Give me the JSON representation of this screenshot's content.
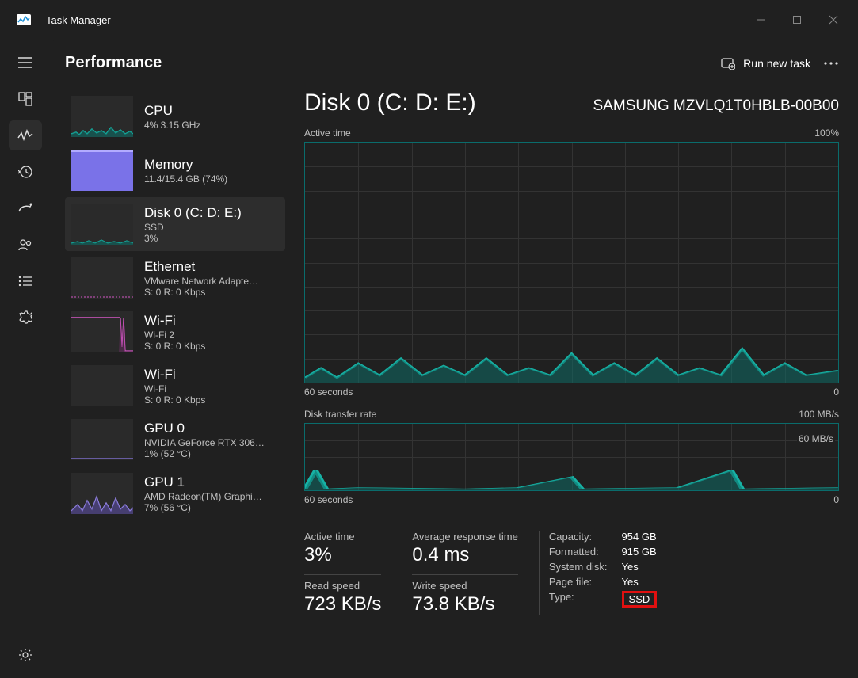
{
  "app": {
    "title": "Task Manager"
  },
  "header": {
    "page_title": "Performance",
    "run_new_task_label": "Run new task"
  },
  "sidebar": {
    "items": [
      {
        "title": "CPU",
        "line1": "4%  3.15 GHz",
        "line2": ""
      },
      {
        "title": "Memory",
        "line1": "11.4/15.4 GB (74%)",
        "line2": ""
      },
      {
        "title": "Disk 0 (C: D: E:)",
        "line1": "SSD",
        "line2": "3%"
      },
      {
        "title": "Ethernet",
        "line1": "VMware Network Adapte…",
        "line2": "S: 0  R: 0 Kbps"
      },
      {
        "title": "Wi-Fi",
        "line1": "Wi-Fi 2",
        "line2": "S: 0  R: 0 Kbps"
      },
      {
        "title": "Wi-Fi",
        "line1": "Wi-Fi",
        "line2": "S: 0  R: 0 Kbps"
      },
      {
        "title": "GPU 0",
        "line1": "NVIDIA GeForce RTX 306…",
        "line2": "1%  (52 °C)"
      },
      {
        "title": "GPU 1",
        "line1": "AMD Radeon(TM) Graphi…",
        "line2": "7%  (56 °C)"
      }
    ]
  },
  "main": {
    "title": "Disk 0 (C: D: E:)",
    "device_name": "SAMSUNG MZVLQ1T0HBLB-00B00",
    "chart1": {
      "label_left": "Active time",
      "label_right": "100%",
      "x_left": "60 seconds",
      "x_right": "0"
    },
    "chart2": {
      "label_left": "Disk transfer rate",
      "label_right": "100 MB/s",
      "inline_label": "60 MB/s",
      "x_left": "60 seconds",
      "x_right": "0"
    },
    "stats": {
      "active_time": {
        "label": "Active time",
        "value": "3%"
      },
      "avg_response": {
        "label": "Average response time",
        "value": "0.4 ms"
      },
      "read_speed": {
        "label": "Read speed",
        "value": "723 KB/s"
      },
      "write_speed": {
        "label": "Write speed",
        "value": "73.8 KB/s"
      }
    },
    "props": {
      "capacity": {
        "label": "Capacity:",
        "value": "954 GB"
      },
      "formatted": {
        "label": "Formatted:",
        "value": "915 GB"
      },
      "system_disk": {
        "label": "System disk:",
        "value": "Yes"
      },
      "page_file": {
        "label": "Page file:",
        "value": "Yes"
      },
      "type": {
        "label": "Type:",
        "value": "SSD"
      }
    }
  },
  "colors": {
    "teal": "#17b1a4",
    "teal_fill": "#0e6c66",
    "purple": "#8c7ae6",
    "magenta": "#d457c5"
  }
}
